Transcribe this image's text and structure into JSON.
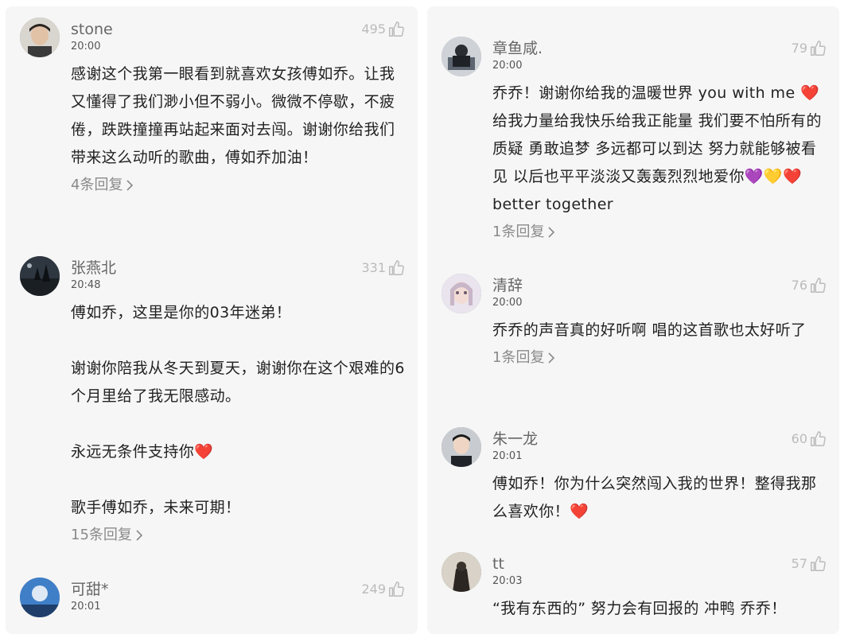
{
  "left": [
    {
      "username": "stone",
      "time": "20:00",
      "likes": "495",
      "text": "感谢这个我第一眼看到就喜欢女孩傅如乔。让我又懂得了我们渺小但不弱小。微微不停歇，不疲倦，跌跌撞撞再站起来面对去闯。谢谢你给我们带来这么动听的歌曲，傅如乔加油！",
      "replies": "4条回复"
    },
    {
      "username": "张燕北",
      "time": "20:48",
      "likes": "331",
      "text": "傅如乔，这里是你的03年迷弟！\n\n谢谢你陪我从冬天到夏天，谢谢你在这个艰难的6个月里给了我无限感动。\n\n永远无条件支持你",
      "emoji": "❤️",
      "text_after": "\n\n歌手傅如乔，未来可期！",
      "replies": "15条回复"
    },
    {
      "username": "可甜*",
      "time": "20:01",
      "likes": "249",
      "text": ""
    }
  ],
  "right": [
    {
      "username": "章鱼咸.",
      "time": "20:00",
      "likes": "79",
      "text_a": "乔乔！谢谢你给我的温暖世界 you with me ",
      "text_b": " 给我力量给我快乐给我正能量 我们要不怕所有的质疑 勇敢追梦 多远都可以到达 努力就能够被看见 以后也平平淡淡又轰轰烈烈地爱你",
      "text_c": "better together",
      "emoji_heart": "❤️",
      "emoji_purple": "💜",
      "emoji_yellow": "💛",
      "replies": "1条回复"
    },
    {
      "username": "清辞",
      "time": "20:00",
      "likes": "76",
      "text": "乔乔的声音真的好听啊 唱的这首歌也太好听了",
      "replies": "1条回复"
    },
    {
      "username": "朱一龙",
      "time": "20:01",
      "likes": "60",
      "text": "傅如乔！你为什么突然闯入我的世界！整得我那么喜欢你！",
      "emoji": "❤️"
    },
    {
      "username": "tt",
      "time": "20:03",
      "likes": "57",
      "text": "“我有东西的” 努力会有回报的 冲鸭 乔乔！"
    }
  ],
  "icons": {
    "like": "thumbs-up-icon",
    "chevron": "chevron-right-icon"
  },
  "colors": {
    "panel_bg": "#f6f6f6",
    "muted": "#8a8a8a",
    "heart": "#e0303c"
  }
}
